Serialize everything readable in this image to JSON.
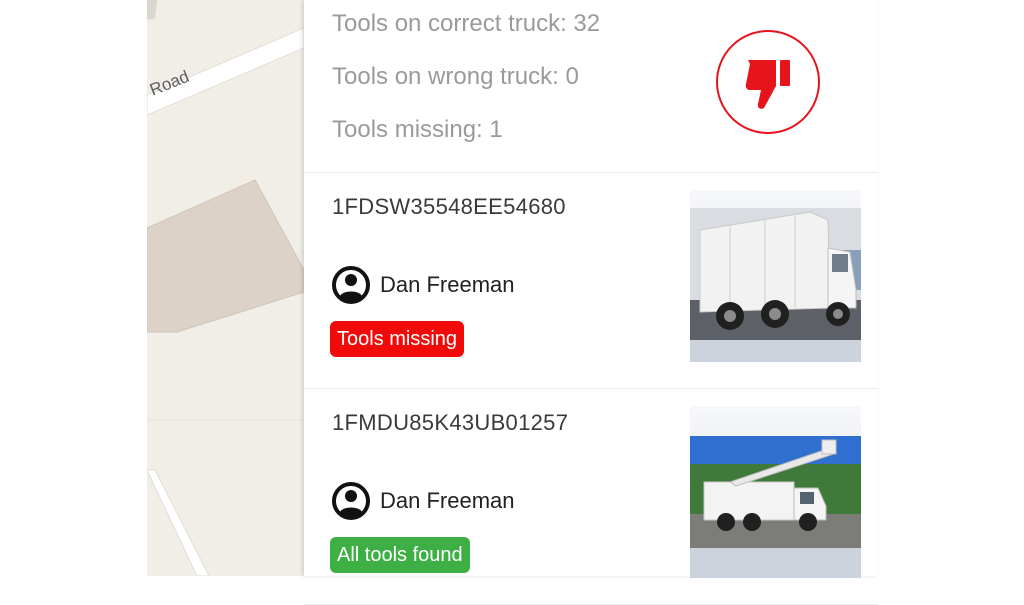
{
  "map": {
    "road_label": "Road"
  },
  "summary": {
    "correct_label": "Tools on correct truck: 32",
    "wrong_label": "Tools on wrong truck: 0",
    "missing_label": "Tools missing: 1",
    "status_icon": "thumbs-down-icon",
    "status_color": "#e8141c"
  },
  "trucks": [
    {
      "vin": "1FDSW35548EE54680",
      "driver": "Dan Freeman",
      "status": "Tools missing",
      "status_color": "#f00a0a",
      "photo": "utility-service-truck"
    },
    {
      "vin": "1FMDU85K43UB01257",
      "driver": "Dan Freeman",
      "status": "All tools found",
      "status_color": "#3daf45",
      "photo": "bucket-truck"
    }
  ]
}
